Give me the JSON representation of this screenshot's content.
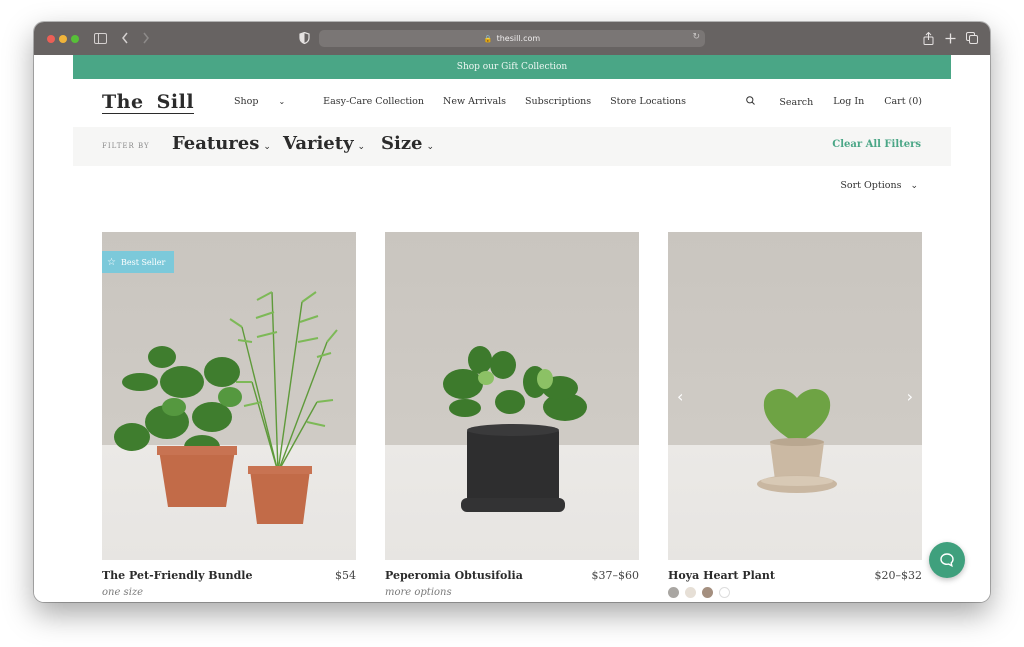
{
  "browser": {
    "url": "thesill.com",
    "icons": [
      "sidebar-toggle-icon",
      "back-arrow-icon",
      "forward-arrow-icon",
      "shield-icon",
      "lock-icon",
      "reload-icon",
      "share-icon",
      "new-tab-icon",
      "tab-overview-icon"
    ]
  },
  "promo_banner": {
    "text": "Shop our Gift Collection"
  },
  "header": {
    "logo": "The Sill",
    "nav": [
      {
        "label": "Shop",
        "has_dropdown": true
      },
      {
        "label": "Easy-Care Collection"
      },
      {
        "label": "New Arrivals"
      },
      {
        "label": "Subscriptions"
      },
      {
        "label": "Store Locations"
      }
    ],
    "search_label": "Search",
    "login_label": "Log In",
    "cart_label": "Cart (0)"
  },
  "filters": {
    "label": "FILTER BY",
    "options": [
      "Features",
      "Variety",
      "Size"
    ],
    "clear_label": "Clear All Filters"
  },
  "sort": {
    "label": "Sort Options"
  },
  "products": [
    {
      "name": "The Pet-Friendly Bundle",
      "price": "$54",
      "subtitle": "one size",
      "badge": "Best Seller"
    },
    {
      "name": "Peperomia Obtusifolia",
      "price": "$37–$60",
      "subtitle": "more options"
    },
    {
      "name": "Hoya Heart Plant",
      "price": "$20–$32",
      "swatches": [
        "#a9a6a2",
        "#e6dfd6",
        "#a48f7f",
        "#ffffff"
      ]
    }
  ],
  "colors": {
    "brand_green": "#4aa686",
    "badge_blue": "#7cc9da",
    "chat_green": "#3fa07d"
  }
}
